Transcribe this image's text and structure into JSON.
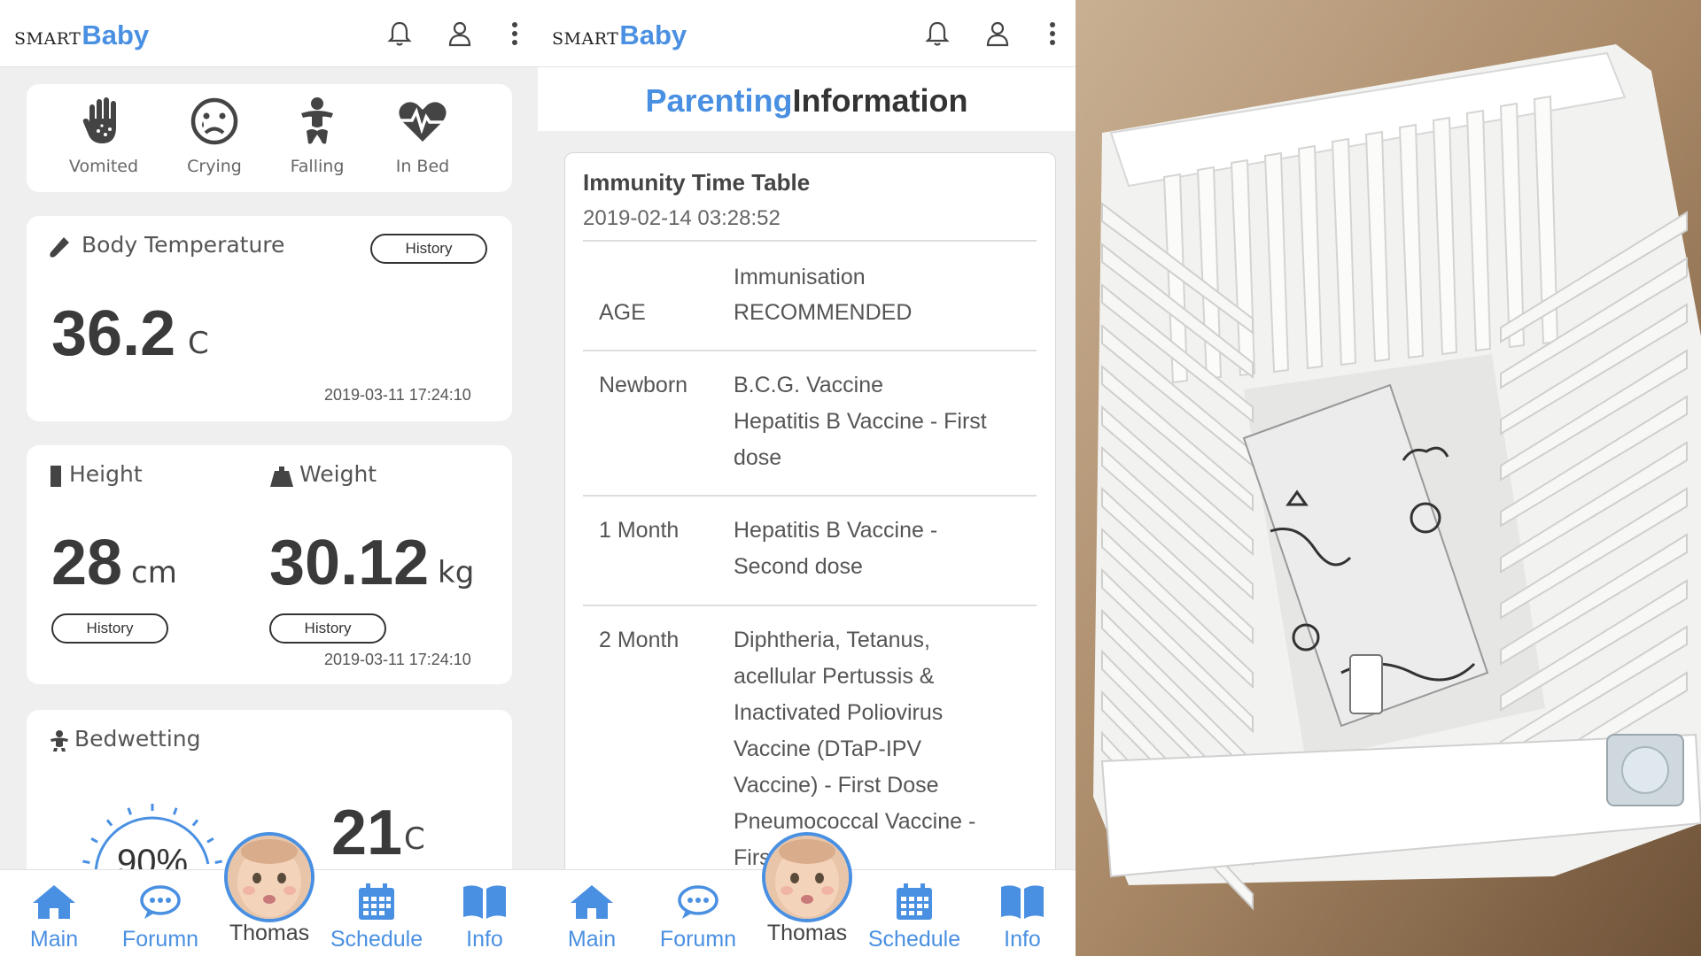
{
  "app": {
    "logo_prefix": "SMART",
    "logo_name": "Baby"
  },
  "colors": {
    "accent": "#4a90e2",
    "card_bg": "#ffffff",
    "page_bg": "#efefef",
    "text_dark": "#3a3a3a"
  },
  "topbar_icons": [
    "bell-icon",
    "user-icon",
    "more-vertical-icon"
  ],
  "status": {
    "items": [
      {
        "label": "Vomited",
        "icon": "hand-icon"
      },
      {
        "label": "Crying",
        "icon": "sad-face-icon"
      },
      {
        "label": "Falling",
        "icon": "baby-icon"
      },
      {
        "label": "In Bed",
        "icon": "heartbeat-icon"
      }
    ]
  },
  "temperature": {
    "title": "Body Temperature",
    "history_label": "History",
    "value": "36.2",
    "unit": "C",
    "timestamp": "2019-03-11 17:24:10"
  },
  "height": {
    "title": "Height",
    "value": "28",
    "unit": "cm",
    "history_label": "History"
  },
  "weight": {
    "title": "Weight",
    "value": "30.12",
    "unit": "kg",
    "history_label": "History",
    "timestamp": "2019-03-11 17:24:10"
  },
  "bedwetting": {
    "title": "Bedwetting",
    "humidity": "90%",
    "humidity_fraction": 0.9,
    "temperature": "21",
    "unit": "C"
  },
  "parenting": {
    "title_accent": "Parenting",
    "title_rest": "Information",
    "table_title": "Immunity Time Table",
    "date": "2019-02-14 03:28:52",
    "header_age": "AGE",
    "header_vac_line1": "Immunisation",
    "header_vac_line2": "RECOMMENDED",
    "rows": [
      {
        "age": "Newborn",
        "lines": [
          "B.C.G. Vaccine",
          "Hepatitis B Vaccine - First",
          "dose"
        ]
      },
      {
        "age": "1 Month",
        "lines": [
          "Hepatitis B Vaccine -",
          "Second dose"
        ]
      },
      {
        "age": "2 Month",
        "lines": [
          "Diphtheria, Tetanus,",
          "acellular Pertussis &",
          "Inactivated Poliovirus",
          "Vaccine (DTaP-IPV",
          "Vaccine) - First Dose",
          "Pneumococcal Vaccine -",
          "Firs"
        ]
      }
    ]
  },
  "nav": {
    "items": [
      {
        "label": "Main",
        "icon": "home-icon"
      },
      {
        "label": "Forumn",
        "icon": "chat-icon"
      },
      {
        "label": "Thomas",
        "icon": "baby-avatar"
      },
      {
        "label": "Schedule",
        "icon": "calendar-icon"
      },
      {
        "label": "Info",
        "icon": "book-icon"
      }
    ]
  }
}
